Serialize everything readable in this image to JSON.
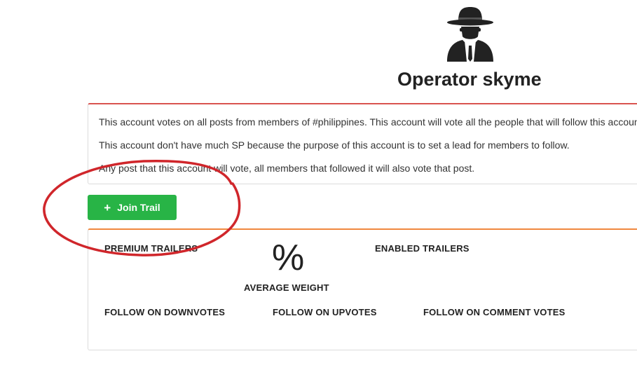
{
  "header": {
    "icon": "spy-agent-icon",
    "title": "Operator skyme"
  },
  "description": {
    "lines": [
      "This account votes on all posts from members of #philippines. This account will vote all the people that will follow this account.",
      "This account don't have much SP because the purpose of this account is to set a lead for members to follow.",
      "Any post that this account will vote, all members that followed it will also vote that post."
    ]
  },
  "actions": {
    "join_label": "Join Trail",
    "join_icon": "plus-icon",
    "join_color": "#28b446"
  },
  "stats": {
    "premium_trailers_label": "PREMIUM TRAILERS",
    "enabled_trailers_label": "ENABLED TRAILERS",
    "percent_value": "%",
    "average_weight_label": "AVERAGE WEIGHT",
    "follow_downvotes_label": "FOLLOW ON DOWNVOTES",
    "follow_upvotes_label": "FOLLOW ON UPVOTES",
    "follow_comment_votes_label": "FOLLOW ON COMMENT VOTES"
  },
  "colors": {
    "description_border": "#d9534f",
    "stats_border": "#f0883e",
    "annotation_circle": "#d0262b"
  }
}
